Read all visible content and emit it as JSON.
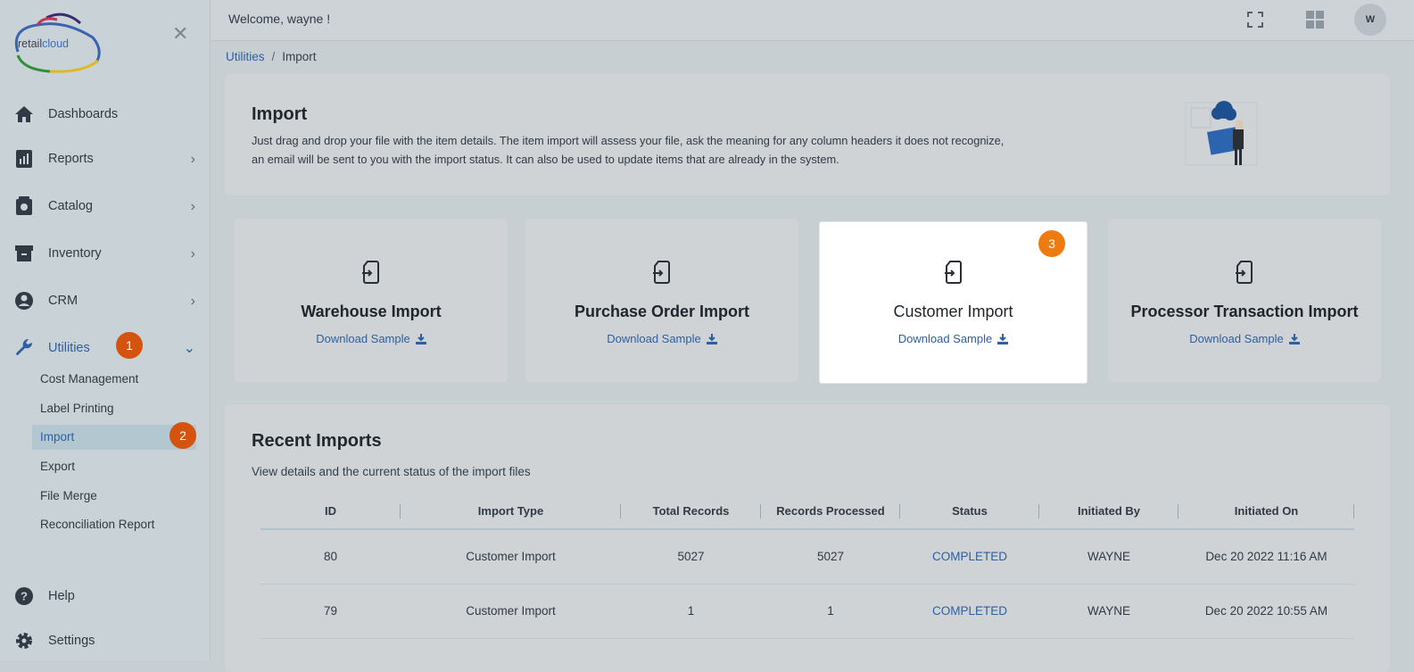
{
  "sidebar": {
    "logo": {
      "prefix": "retail",
      "suffix": "cloud"
    },
    "close_icon": "close-icon",
    "items": [
      {
        "label": "Dashboards",
        "icon": "home-icon"
      },
      {
        "label": "Reports",
        "icon": "report-icon"
      },
      {
        "label": "Catalog",
        "icon": "catalog-icon"
      },
      {
        "label": "Inventory",
        "icon": "inventory-icon"
      },
      {
        "label": "CRM",
        "icon": "user-circle-icon"
      },
      {
        "label": "Utilities",
        "icon": "wrench-icon"
      }
    ],
    "utilities_sub": [
      "Cost Management",
      "Label Printing",
      "Import",
      "Export",
      "File Merge",
      "Reconciliation Report"
    ],
    "bottom": [
      {
        "label": "Help",
        "icon": "help-icon"
      },
      {
        "label": "Settings",
        "icon": "gear-icon"
      }
    ],
    "badges": [
      "1",
      "2"
    ]
  },
  "topbar": {
    "welcome": "Welcome, wayne !",
    "avatar_initial": "W"
  },
  "breadcrumb": {
    "parent": "Utilities",
    "separator": "/",
    "current": "Import"
  },
  "intro": {
    "title": "Import",
    "description": "Just drag and drop your file with the item details. The item import will assess your file, ask the meaning for any column headers it does not recognize, an email will be sent to you with the import status. It can also be used to update items that are already in the system."
  },
  "import_cards": [
    {
      "title": "Warehouse Import",
      "link": "Download Sample"
    },
    {
      "title": "Purchase Order Import",
      "link": "Download Sample"
    },
    {
      "title": "Customer Import",
      "link": "Download Sample",
      "badge": "3"
    },
    {
      "title": "Processor Transaction Import",
      "link": "Download Sample"
    }
  ],
  "recent": {
    "title": "Recent Imports",
    "subtitle": "View details and the current status of the import files",
    "columns": [
      "ID",
      "Import Type",
      "Total Records",
      "Records Processed",
      "Status",
      "Initiated By",
      "Initiated On"
    ],
    "rows": [
      [
        "80",
        "Customer Import",
        "5027",
        "5027",
        "COMPLETED",
        "WAYNE",
        "Dec 20 2022 11:16 AM"
      ],
      [
        "79",
        "Customer Import",
        "1",
        "1",
        "COMPLETED",
        "WAYNE",
        "Dec 20 2022 10:55 AM"
      ]
    ]
  },
  "colors": {
    "accent": "#2e5fa0",
    "badge": "#d4530e",
    "highlight_card": "#ffffff"
  }
}
